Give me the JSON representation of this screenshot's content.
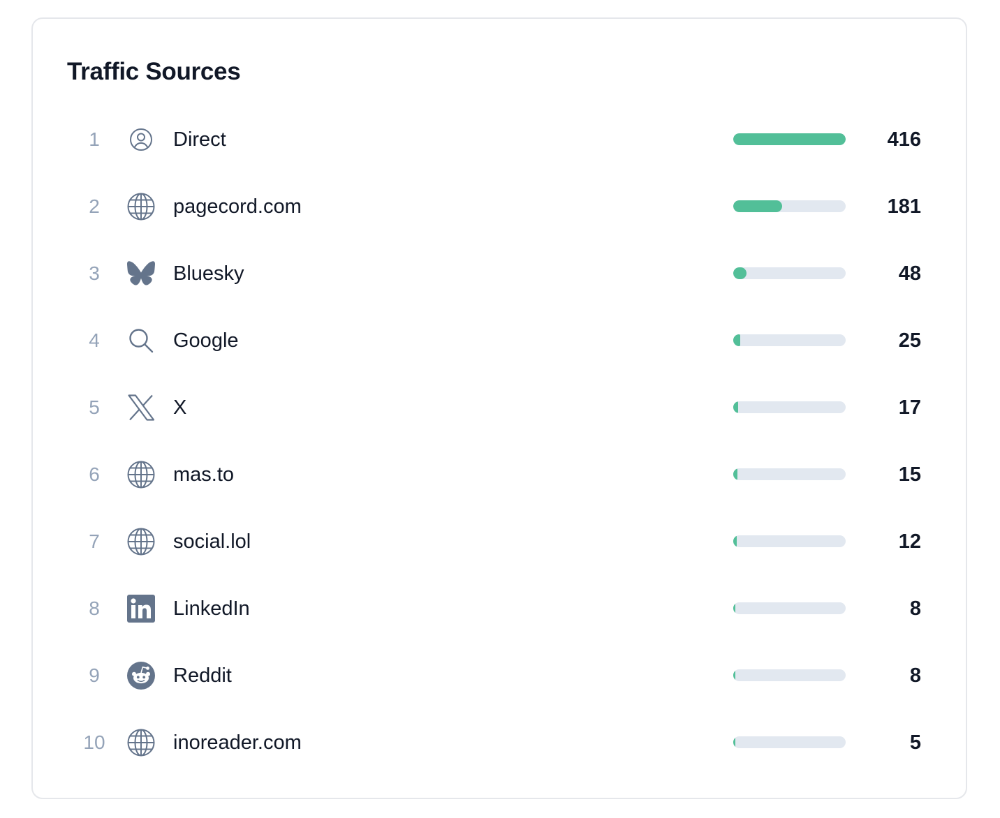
{
  "card": {
    "title": "Traffic Sources"
  },
  "accent_color": "#52bf98",
  "track_color": "#e2e8f0",
  "icon_color": "#64748b",
  "max_value": 416,
  "sources": [
    {
      "rank": "1",
      "label": "Direct",
      "value": 416,
      "icon": "user-circle-icon"
    },
    {
      "rank": "2",
      "label": "pagecord.com",
      "value": 181,
      "icon": "globe-icon"
    },
    {
      "rank": "3",
      "label": "Bluesky",
      "value": 48,
      "icon": "bluesky-icon"
    },
    {
      "rank": "4",
      "label": "Google",
      "value": 25,
      "icon": "search-icon"
    },
    {
      "rank": "5",
      "label": "X",
      "value": 17,
      "icon": "x-logo-icon"
    },
    {
      "rank": "6",
      "label": "mas.to",
      "value": 15,
      "icon": "globe-icon"
    },
    {
      "rank": "7",
      "label": "social.lol",
      "value": 12,
      "icon": "globe-icon"
    },
    {
      "rank": "8",
      "label": "LinkedIn",
      "value": 8,
      "icon": "linkedin-icon"
    },
    {
      "rank": "9",
      "label": "Reddit",
      "value": 8,
      "icon": "reddit-icon"
    },
    {
      "rank": "10",
      "label": "inoreader.com",
      "value": 5,
      "icon": "globe-icon"
    }
  ]
}
